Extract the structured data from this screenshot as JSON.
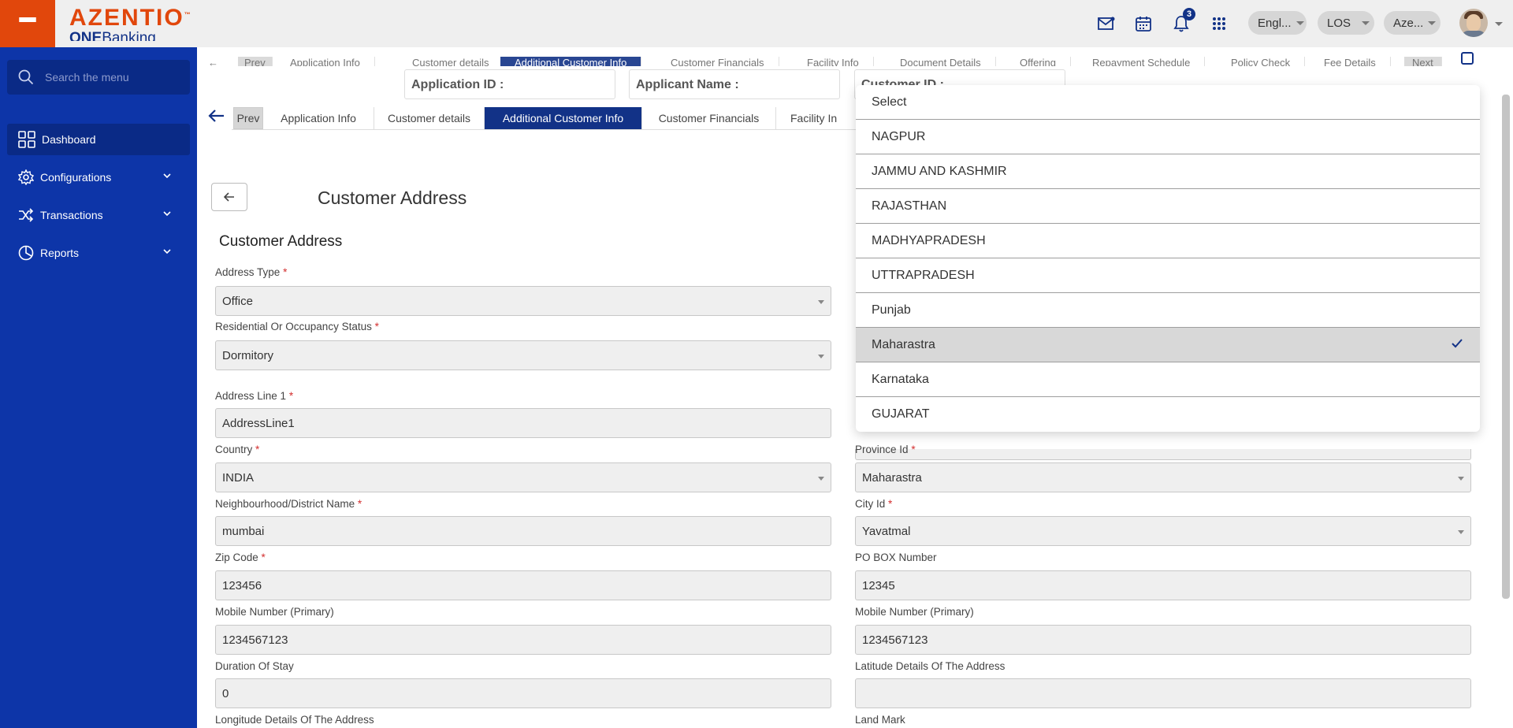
{
  "header": {
    "logo_main": "AZENTIO",
    "logo_tm": "™",
    "logo_sub_bold": "ONE",
    "logo_sub": "Banking",
    "notification_count": "3",
    "language": "Engl...",
    "module": "LOS",
    "entity": "Aze..."
  },
  "sidebar": {
    "search_placeholder": "Search the menu",
    "items": [
      {
        "label": "Dashboard",
        "icon": "dashboard-icon"
      },
      {
        "label": "Configurations",
        "icon": "gear-icon"
      },
      {
        "label": "Transactions",
        "icon": "shuffle-icon"
      },
      {
        "label": "Reports",
        "icon": "pie-chart-icon"
      }
    ]
  },
  "ghost_tabs": [
    "Prev",
    "Application Info",
    "Customer details",
    "Additional Customer Info",
    "Customer Financials",
    "Facility Info",
    "Document Details",
    "Offering",
    "Repayment Schedule",
    "Policy Check",
    "Fee Details",
    "Next"
  ],
  "info": {
    "application_id": "Application ID :",
    "applicant_name": "Applicant Name :",
    "customer_id": "Customer ID :"
  },
  "tabs": {
    "prev": "Prev",
    "items": [
      "Application Info",
      "Customer details",
      "Additional Customer Info",
      "Customer Financials",
      "Facility In"
    ]
  },
  "page_title": "Customer Address",
  "section_title": "Customer Address",
  "form": {
    "address_type": {
      "label": "Address Type",
      "value": "Office"
    },
    "occupancy": {
      "label": "Residential Or Occupancy Status",
      "value": "Dormitory"
    },
    "address_line1": {
      "label": "Address Line 1",
      "value": "AddressLine1"
    },
    "country": {
      "label": "Country",
      "value": "INDIA"
    },
    "province": {
      "label": "Province Id",
      "value": "Maharastra"
    },
    "district": {
      "label": "Neighbourhood/District Name",
      "value": "mumbai"
    },
    "city": {
      "label": "City Id",
      "value": "Yavatmal"
    },
    "zip": {
      "label": "Zip Code",
      "value": "123456"
    },
    "pobox": {
      "label": "PO BOX Number",
      "value": "12345"
    },
    "mobile1": {
      "label": "Mobile Number (Primary)",
      "value": "1234567123"
    },
    "mobile2": {
      "label": "Mobile Number (Primary)",
      "value": "1234567123"
    },
    "duration": {
      "label": "Duration Of Stay",
      "value": "0"
    },
    "latitude": {
      "label": "Latitude Details Of The Address",
      "value": ""
    },
    "longitude": {
      "label": "Longitude Details Of The Address"
    },
    "landmark": {
      "label": "Land Mark"
    }
  },
  "required_mark": "*",
  "dropdown": {
    "options": [
      "Select",
      "NAGPUR",
      "JAMMU AND KASHMIR",
      "RAJASTHAN",
      "MADHYAPRADESH",
      "UTTRAPRADESH",
      "Punjab",
      "Maharastra",
      "Karnataka",
      "GUJARAT"
    ],
    "selected": "Maharastra"
  },
  "colors": {
    "brand_orange": "#e1470c",
    "brand_blue": "#123287",
    "sidebar_blue": "#0d35a8"
  }
}
